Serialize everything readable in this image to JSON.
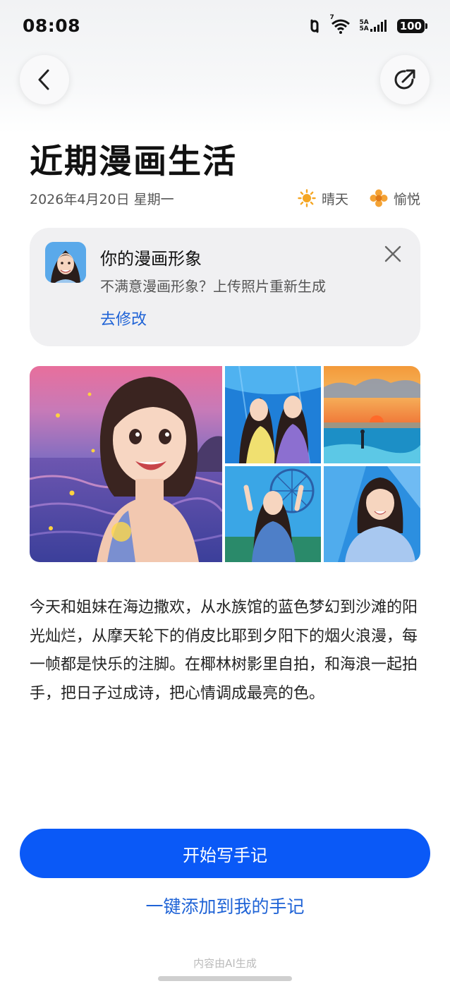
{
  "status_bar": {
    "time": "08:08",
    "network_label_top": "5A",
    "network_label_bottom": "5A",
    "wifi_label": "7",
    "battery": "100"
  },
  "nav": {
    "back_icon": "chevron-left-icon",
    "share_icon": "share-arrow-icon"
  },
  "diary": {
    "title": "近期漫画生活",
    "date": "2026年4月20日 星期一",
    "weather": "晴天",
    "mood": "愉悦"
  },
  "avatar_card": {
    "title": "你的漫画形象",
    "subtitle": "不满意漫画形象？上传照片重新生成",
    "link": "去修改"
  },
  "story": "今天和姐妹在海边撒欢，从水族馆的蓝色梦幻到沙滩的阳光灿烂，从摩天轮下的俏皮比耶到夕阳下的烟火浪漫，每一帧都是快乐的注脚。在椰林树影里自拍，和海浪一起拍手，把日子过成诗，把心情调成最亮的色。",
  "actions": {
    "primary": "开始写手记",
    "secondary": "一键添加到我的手记"
  },
  "footer_note": "内容由AI生成",
  "colors": {
    "accent": "#0a59f7",
    "link": "#1f63d6",
    "sun": "#f5a623"
  }
}
